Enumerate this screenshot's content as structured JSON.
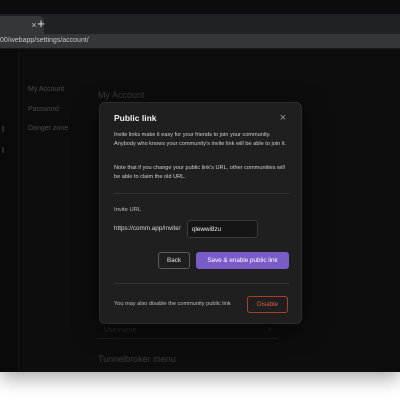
{
  "browser": {
    "url": "00/webapp/settings/account/",
    "tab_close_glyph": "×",
    "new_tab_glyph": "+"
  },
  "background": {
    "sidebar_items": [
      "My Account",
      "Password",
      "Danger zone"
    ],
    "page_title": "My Account",
    "field_text": "Username",
    "section_title": "Tunnelbroker menu"
  },
  "modal": {
    "title": "Public link",
    "close_glyph": "×",
    "description_1": "Invite links make it easy for your friends to join your community. Anybody who knows your community's invite link will be able to join it.",
    "description_2": "Note that if you change your public link's URL, other communities will be able to claim the old URL.",
    "invite_label": "Invite URL",
    "invite_prefix": "https://comm.app/invite/",
    "invite_value": "qlewwi8zu",
    "back_label": "Back",
    "enable_label": "Save & enable public link",
    "disable_note": "You may also disable the community public link",
    "disable_label": "Disable"
  },
  "colors": {
    "primary_button": "#7a5cc8",
    "danger": "#e05a40",
    "modal_bg": "#1f1f1f",
    "app_bg": "#0d0d0d"
  }
}
